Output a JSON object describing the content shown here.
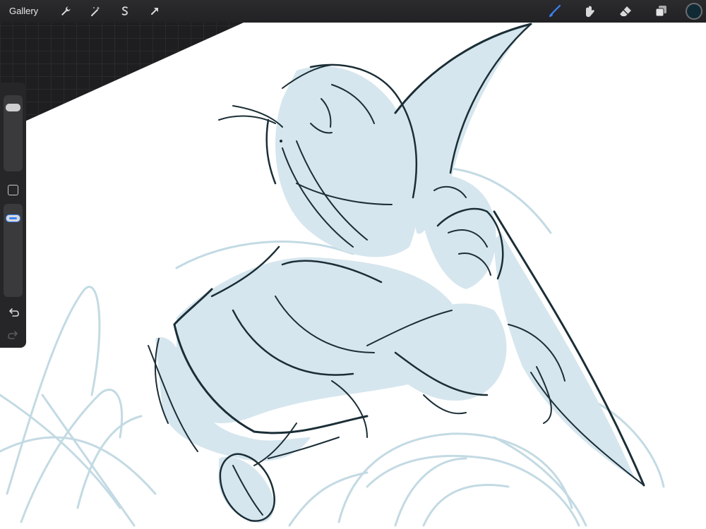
{
  "toolbar": {
    "gallery_label": "Gallery",
    "left_icons": [
      "wrench-icon",
      "magic-wand-icon",
      "selection-s-icon",
      "transform-arrow-icon"
    ],
    "right_icons": [
      "brush-icon",
      "smudge-icon",
      "eraser-icon",
      "layers-icon"
    ],
    "active_tool": "brush-icon",
    "current_color": "#0f2a34"
  },
  "sidebar": {
    "brush_size": 0.1,
    "brush_opacity": 0.1,
    "icons": [
      "modify-square-icon",
      "undo-icon",
      "redo-icon"
    ]
  },
  "colors": {
    "accent": "#3b82f6",
    "ink": "#1b2e36",
    "fill": "#d6e6ee",
    "sketch": "#b7d2de"
  }
}
